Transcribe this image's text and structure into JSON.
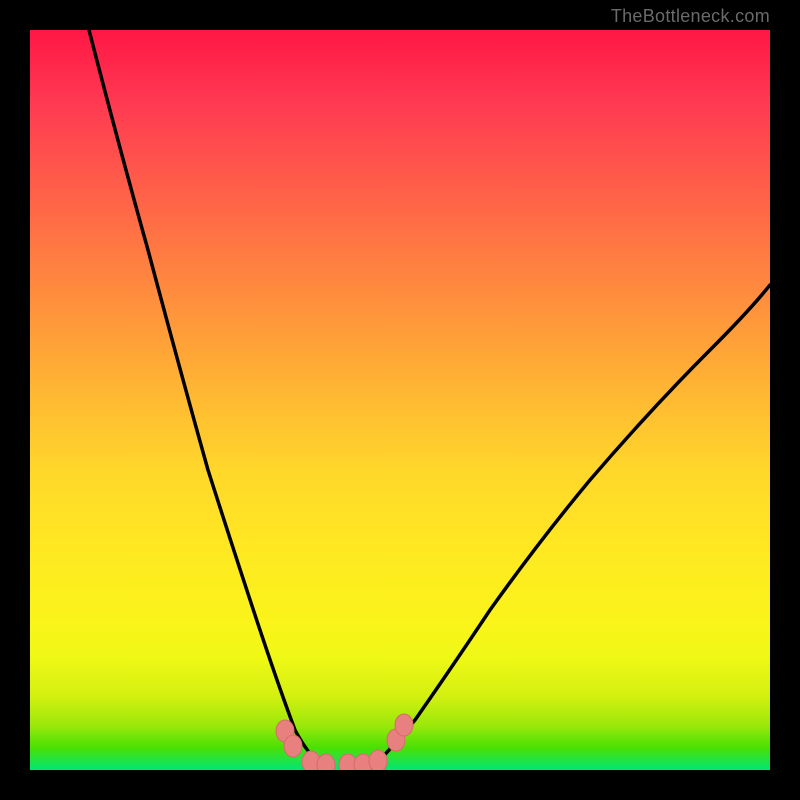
{
  "watermark": "TheBottleneck.com",
  "chart_data": {
    "type": "line",
    "title": "",
    "xlabel": "",
    "ylabel": "",
    "xlim": [
      0,
      100
    ],
    "ylim": [
      0,
      100
    ],
    "series": [
      {
        "name": "left-curve",
        "x": [
          8,
          12,
          16,
          20,
          24,
          28,
          30,
          32,
          34,
          35,
          36,
          38,
          40
        ],
        "y": [
          100,
          80,
          62,
          46,
          32,
          20,
          14,
          9,
          6,
          4,
          3,
          1,
          0
        ]
      },
      {
        "name": "right-curve",
        "x": [
          46,
          48,
          50,
          52,
          55,
          60,
          65,
          70,
          75,
          80,
          85,
          90,
          95,
          100
        ],
        "y": [
          0,
          1,
          3,
          5,
          9,
          15,
          22,
          29,
          36,
          43,
          50,
          56,
          62,
          68
        ]
      }
    ],
    "markers": {
      "name": "data-points",
      "color": "#e88080",
      "x": [
        34.5,
        35.5,
        38,
        40,
        43,
        45,
        47,
        49.5,
        50.5
      ],
      "y": [
        5,
        3,
        0.8,
        0.5,
        0.5,
        0.5,
        1,
        4,
        6
      ]
    },
    "gradient_background": {
      "type": "vertical",
      "top": "#ff1744",
      "middle": "#ffd82a",
      "bottom": "#00e676"
    }
  }
}
